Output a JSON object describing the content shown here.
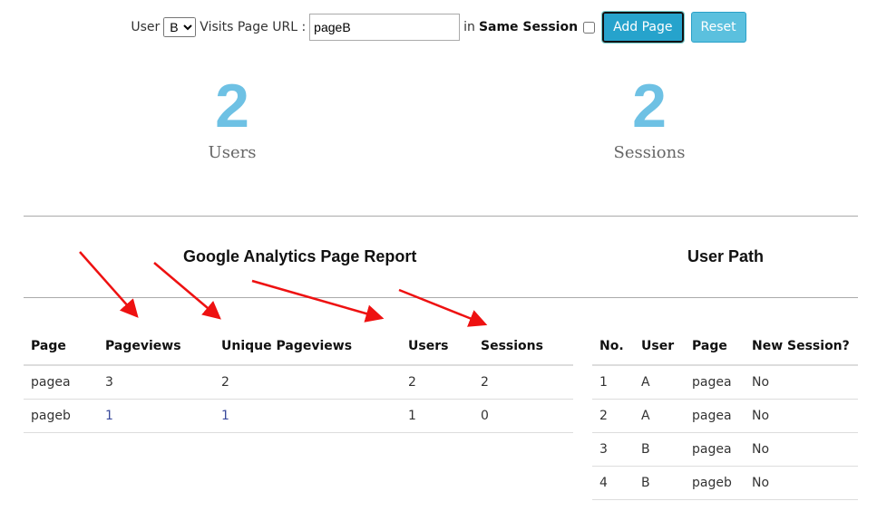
{
  "form": {
    "user_label": "User",
    "user_value": "B",
    "visits_label": "Visits Page URL :",
    "url_value": "pageB",
    "in_label": "in",
    "same_session_label": "Same Session",
    "same_session_checked": false,
    "add_label": "Add Page",
    "reset_label": "Reset"
  },
  "stats": {
    "users": {
      "value": "2",
      "label": "Users"
    },
    "sessions": {
      "value": "2",
      "label": "Sessions"
    }
  },
  "report": {
    "title": "Google Analytics Page Report",
    "headers": [
      "Page",
      "Pageviews",
      "Unique Pageviews",
      "Users",
      "Sessions"
    ],
    "rows": [
      [
        "pagea",
        "3",
        "2",
        "2",
        "2"
      ],
      [
        "pageb",
        "1",
        "1",
        "1",
        "0"
      ]
    ]
  },
  "path": {
    "title": "User Path",
    "headers": [
      "No.",
      "User",
      "Page",
      "New Session?"
    ],
    "rows": [
      [
        "1",
        "A",
        "pagea",
        "No"
      ],
      [
        "2",
        "A",
        "pagea",
        "No"
      ],
      [
        "3",
        "B",
        "pagea",
        "No"
      ],
      [
        "4",
        "B",
        "pageb",
        "No"
      ]
    ]
  },
  "colors": {
    "accent": "#6ec1e4",
    "button": "#31b0d5",
    "arrow": "#ee1111"
  }
}
